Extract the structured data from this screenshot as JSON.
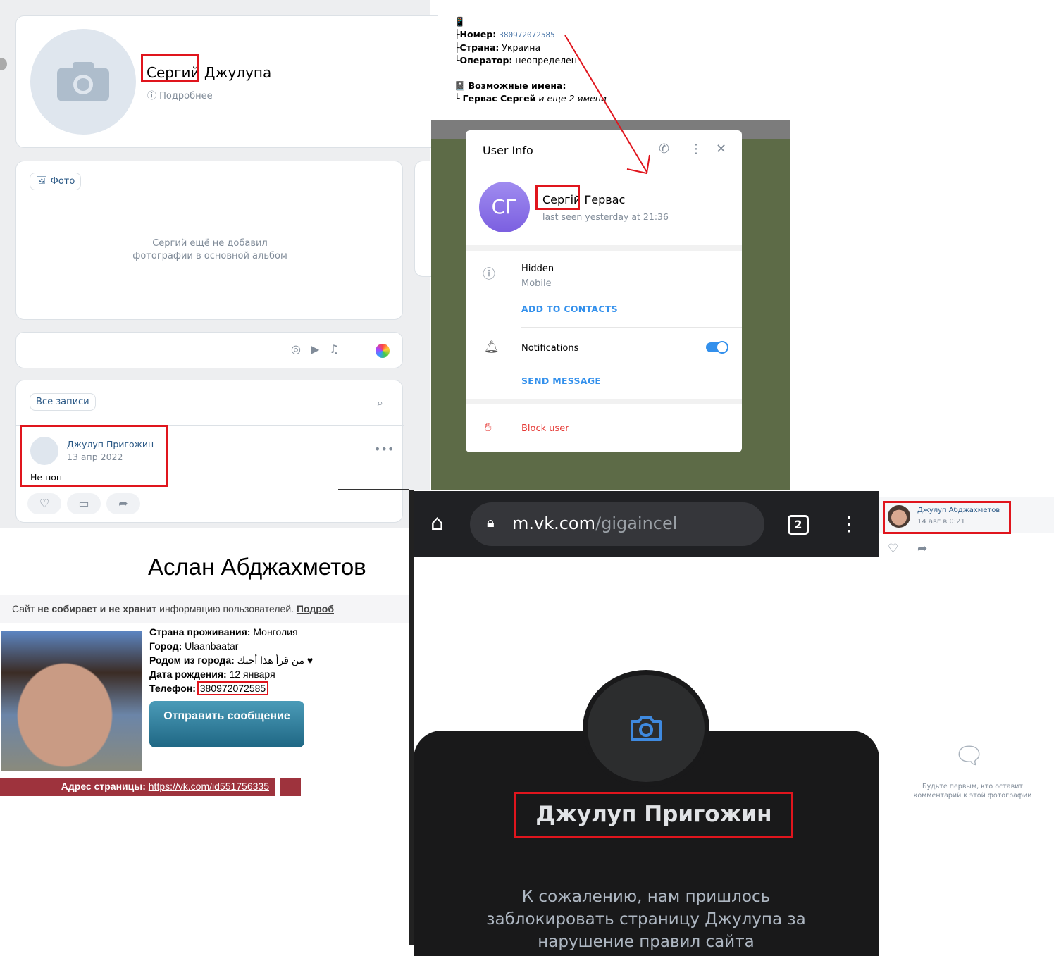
{
  "vk_profile": {
    "first_name": "Сергий",
    "last_name": "Джулупа",
    "details_link": "Подробнее",
    "photos_button": "Фото",
    "photos_empty": "Сергий ещё не добавил",
    "photos_empty2": "фотографии в основной альбом",
    "all_posts": "Все записи",
    "post": {
      "author": "Джулуп Пригожин",
      "date": "13 апр 2022",
      "text": "Не пон"
    }
  },
  "phone_lookup": {
    "number_label": "Номер:",
    "number": "380972072585",
    "country_label": "Страна:",
    "country": "Украина",
    "operator_label": "Оператор:",
    "operator": "неопределен",
    "names_label": "Возможные имена:",
    "names": "Гервас Сергей",
    "names_more": "и еще 2 имени"
  },
  "telegram": {
    "title": "User Info",
    "initials": "СГ",
    "first_name": "Сергій",
    "last_name": "Гервас",
    "last_seen": "last seen yesterday at 21:36",
    "phone": "Hidden",
    "phone_label": "Mobile",
    "add_contacts": "ADD TO CONTACTS",
    "notifications": "Notifications",
    "notifications_on": true,
    "send_message": "SEND MESSAGE",
    "block_user": "Block user",
    "accent": "#3390ec",
    "danger": "#e53935"
  },
  "lookup_site": {
    "name": "Аслан Абджахметов",
    "notice_pre": "Сайт ",
    "notice_bold": "не собирает и не хранит",
    "notice_post": " информацию пользователей. ",
    "notice_link": "Подроб",
    "fields": [
      {
        "label": "Страна проживания:",
        "value": "Монголия"
      },
      {
        "label": "Город:",
        "value": "Ulaanbaatar"
      },
      {
        "label": "Родом из города:",
        "value": "من قرأ هذا أحبك ♥"
      },
      {
        "label": "Дата рождения:",
        "value": "12 января"
      },
      {
        "label": "Телефон:",
        "value": "380972072585"
      }
    ],
    "send_button": "Отправить сообщение",
    "address_label": "Адрес страницы:",
    "address": "https://vk.com/id551756335"
  },
  "mobile": {
    "url_domain": "m.vk.com",
    "url_path": "/gigaincel",
    "tabs_count": "2",
    "name": "Джулуп Пригожин",
    "blocked": "К сожалению, нам пришлось заблокировать страницу Джулупа за нарушение правил сайта"
  },
  "photo_post": {
    "author": "Джулуп Абджахметов",
    "date": "14 авг в 0:21",
    "empty_comments": "Будьте первым, кто оставит комментарий к этой фотографии"
  }
}
